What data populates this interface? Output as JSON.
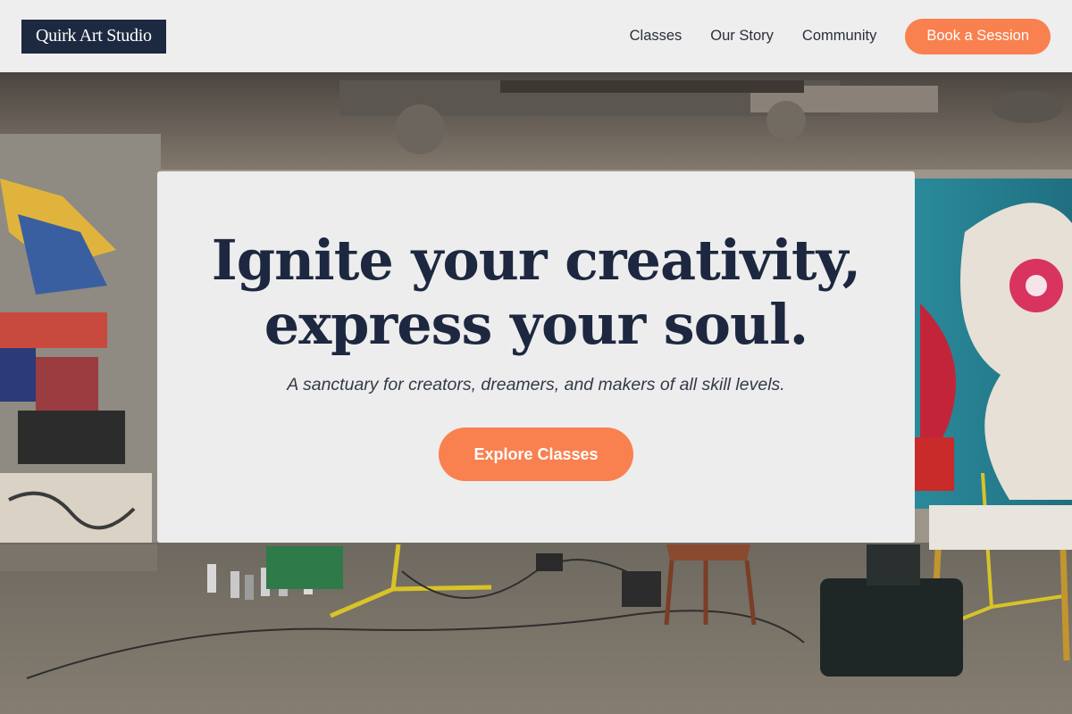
{
  "header": {
    "logo_text": "Quirk Art Studio",
    "nav": [
      {
        "label": "Classes"
      },
      {
        "label": "Our Story"
      },
      {
        "label": "Community"
      }
    ],
    "cta_label": "Book a Session"
  },
  "hero": {
    "title_line1": "Ignite your creativity,",
    "title_line2": "express your soul.",
    "subtitle": "A sanctuary for creators, dreamers, and makers of all skill levels.",
    "button_label": "Explore Classes"
  },
  "colors": {
    "brand_navy": "#1c2940",
    "accent_orange": "#f9804f",
    "header_bg": "#f4f4f4"
  }
}
